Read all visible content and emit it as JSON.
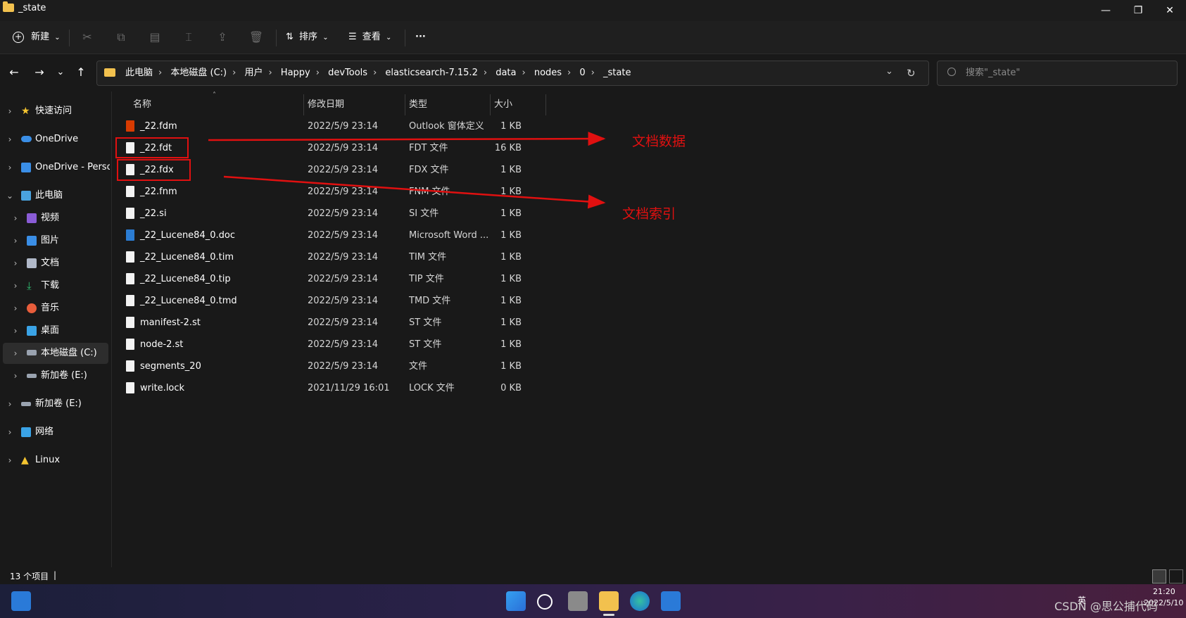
{
  "window": {
    "title": "_state",
    "minimize_glyph": "—",
    "restore_glyph": "❐",
    "close_glyph": "✕"
  },
  "toolbar": {
    "new_label": "新建",
    "sort_label": "排序",
    "view_label": "查看",
    "more_label": "···",
    "icons": [
      "cut-icon",
      "copy-icon",
      "paste-icon",
      "rename-icon",
      "share-icon",
      "delete-icon"
    ]
  },
  "navigation": {
    "back": "←",
    "forward": "→",
    "recent": "⌄",
    "up": "↑",
    "breadcrumbs": [
      "此电脑",
      "本地磁盘 (C:)",
      "用户",
      "Happy",
      "devTools",
      "elasticsearch-7.15.2",
      "data",
      "nodes",
      "0",
      "_state"
    ],
    "separator": "›",
    "dropdown": "⌄",
    "refresh": "↻",
    "search_placeholder": "搜索\"_state\""
  },
  "sidebar": {
    "items": [
      {
        "label": "快速访问",
        "icon": "star-icon",
        "color": "#f4c430"
      },
      {
        "label": "OneDrive",
        "icon": "cloud-icon",
        "color": "#3a8ee6"
      },
      {
        "label": "OneDrive - Persor",
        "icon": "cloud-business-icon",
        "color": "#3a8ee6"
      },
      {
        "label": "此电脑",
        "icon": "computer-icon",
        "color": "#4aa3df"
      },
      {
        "label": "视频",
        "icon": "video-icon",
        "color": "#8a5cd6"
      },
      {
        "label": "图片",
        "icon": "pictures-icon",
        "color": "#3a8ee6"
      },
      {
        "label": "文档",
        "icon": "documents-icon",
        "color": "#b0b8c8"
      },
      {
        "label": "下载",
        "icon": "download-icon",
        "color": "#2fbf71"
      },
      {
        "label": "音乐",
        "icon": "music-icon",
        "color": "#e85d3b"
      },
      {
        "label": "桌面",
        "icon": "desktop-icon",
        "color": "#3aa3e6"
      },
      {
        "label": "本地磁盘 (C:)",
        "icon": "drive-c-icon",
        "color": "#9aa3b0"
      },
      {
        "label": "新加卷 (E:)",
        "icon": "drive-e-icon",
        "color": "#9aa3b0"
      },
      {
        "label": "新加卷 (E:)",
        "icon": "drive-e-icon",
        "color": "#9aa3b0"
      },
      {
        "label": "网络",
        "icon": "network-icon",
        "color": "#3aa3e6"
      },
      {
        "label": "Linux",
        "icon": "linux-icon",
        "color": "#f4c430"
      }
    ]
  },
  "columns": {
    "name": "名称",
    "date": "修改日期",
    "type": "类型",
    "size": "大小"
  },
  "files": [
    {
      "name": "_22.fdm",
      "date": "2022/5/9 23:14",
      "type": "Outlook 窗体定义",
      "size": "1 KB",
      "icon": "office"
    },
    {
      "name": "_22.fdt",
      "date": "2022/5/9 23:14",
      "type": "FDT 文件",
      "size": "16 KB",
      "icon": "file"
    },
    {
      "name": "_22.fdx",
      "date": "2022/5/9 23:14",
      "type": "FDX 文件",
      "size": "1 KB",
      "icon": "file"
    },
    {
      "name": "_22.fnm",
      "date": "2022/5/9 23:14",
      "type": "FNM 文件",
      "size": "1 KB",
      "icon": "file"
    },
    {
      "name": "_22.si",
      "date": "2022/5/9 23:14",
      "type": "SI 文件",
      "size": "1 KB",
      "icon": "file"
    },
    {
      "name": "_22_Lucene84_0.doc",
      "date": "2022/5/9 23:14",
      "type": "Microsoft Word ...",
      "size": "1 KB",
      "icon": "word"
    },
    {
      "name": "_22_Lucene84_0.tim",
      "date": "2022/5/9 23:14",
      "type": "TIM 文件",
      "size": "1 KB",
      "icon": "file"
    },
    {
      "name": "_22_Lucene84_0.tip",
      "date": "2022/5/9 23:14",
      "type": "TIP 文件",
      "size": "1 KB",
      "icon": "file"
    },
    {
      "name": "_22_Lucene84_0.tmd",
      "date": "2022/5/9 23:14",
      "type": "TMD 文件",
      "size": "1 KB",
      "icon": "file"
    },
    {
      "name": "manifest-2.st",
      "date": "2022/5/9 23:14",
      "type": "ST 文件",
      "size": "1 KB",
      "icon": "file"
    },
    {
      "name": "node-2.st",
      "date": "2022/5/9 23:14",
      "type": "ST 文件",
      "size": "1 KB",
      "icon": "file"
    },
    {
      "name": "segments_20",
      "date": "2022/5/9 23:14",
      "type": "文件",
      "size": "1 KB",
      "icon": "file"
    },
    {
      "name": "write.lock",
      "date": "2021/11/29 16:01",
      "type": "LOCK 文件",
      "size": "0 KB",
      "icon": "file"
    }
  ],
  "annotations": {
    "fdt_label": "文档数据",
    "fdx_label": "文档索引",
    "color": "#e01010"
  },
  "status": {
    "count": "13 个项目",
    "cursor": "|"
  },
  "taskbar": {
    "tray_lang": "英",
    "time": "21:20",
    "date": "2022/5/10",
    "watermark": "CSDN @思公捕代码"
  }
}
